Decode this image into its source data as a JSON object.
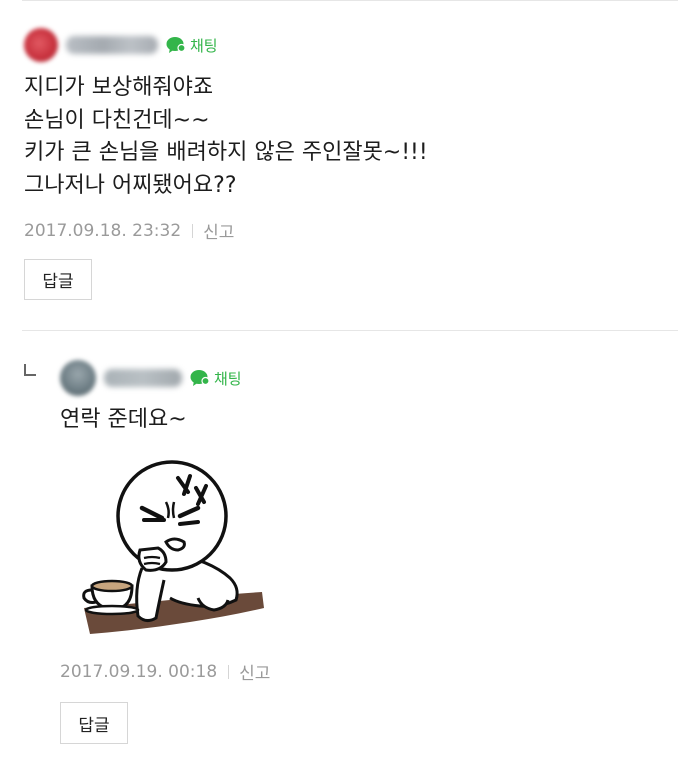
{
  "comments": [
    {
      "chat_label": "채팅",
      "text": "지디가 보상해줘야죠\n손님이 다친건데~~\n키가 큰 손님을 배려하지 않은 주인잘못~!!!\n그나저나 어찌됐어요??",
      "date": "2017.09.18. 23:32",
      "report_label": "신고",
      "reply_label": "답글"
    },
    {
      "chat_label": "채팅",
      "text": "연락 준데요~",
      "sticker_icon": "angry-face-with-coffee-sticker",
      "date": "2017.09.19. 00:18",
      "report_label": "신고",
      "reply_label": "답글"
    }
  ],
  "colors": {
    "chat_green": "#33b54a",
    "meta_grey": "#9a9a9a",
    "divider": "#e6e6e6"
  }
}
